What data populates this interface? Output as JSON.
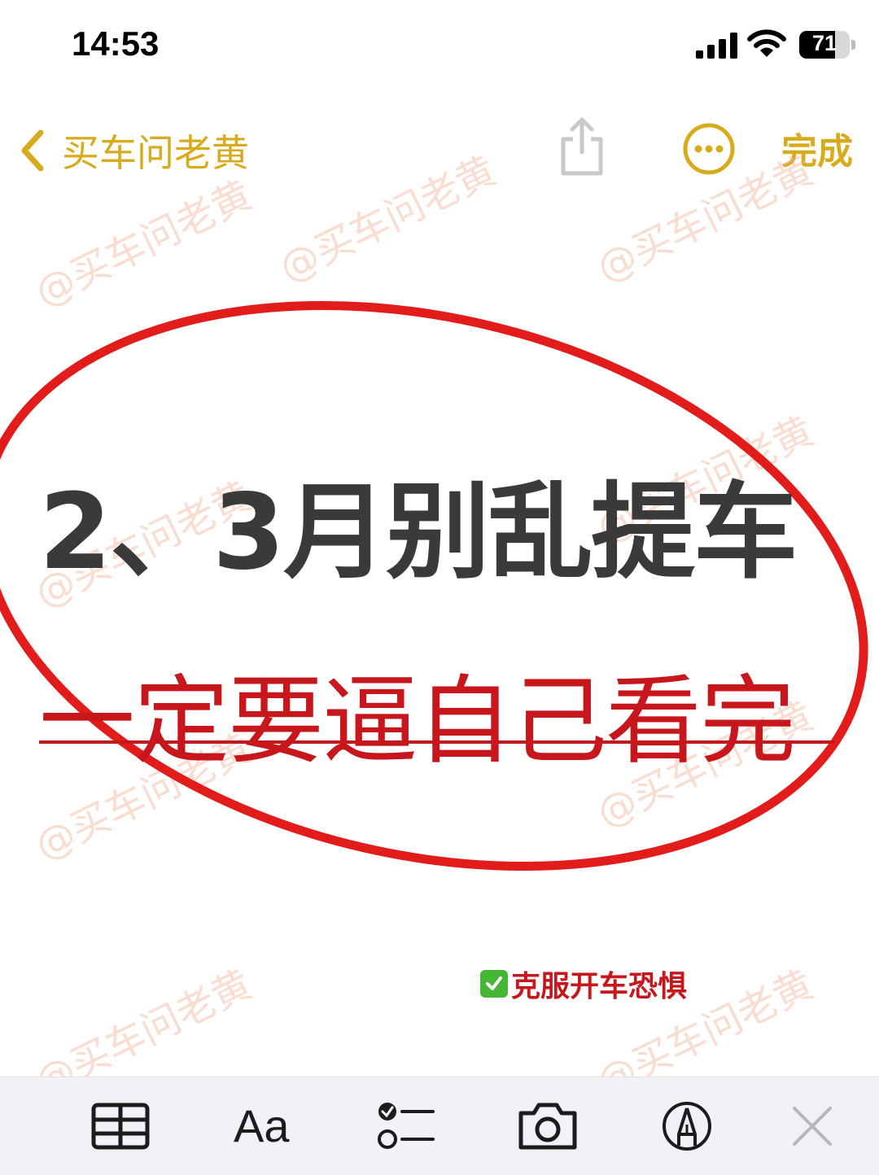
{
  "status_bar": {
    "time": "14:53",
    "battery_level": "71",
    "battery_fraction": 0.71,
    "icons": [
      "cellular-signal-icon",
      "wifi-icon",
      "battery-icon"
    ]
  },
  "nav": {
    "back_label": "买车问老黄",
    "done_label": "完成",
    "accent_color": "#d8ab1d",
    "icons": [
      "chevron-left-icon",
      "share-icon",
      "more-icon"
    ]
  },
  "content": {
    "headline": "2、3月别乱提车",
    "subheadline": "一定要逼自己看完",
    "tag_text": "克服开车恐惧",
    "tag_icon": "check-mark-button-icon",
    "headline_color": "#3a3a3a",
    "emphasis_color": "#c8161d"
  },
  "watermark": {
    "text": "@买车问老黄"
  },
  "toolbar": {
    "aa_label": "Aa",
    "icons": [
      "table-icon",
      "text-format-icon",
      "checklist-icon",
      "camera-icon",
      "markup-pen-icon",
      "close-icon"
    ]
  }
}
